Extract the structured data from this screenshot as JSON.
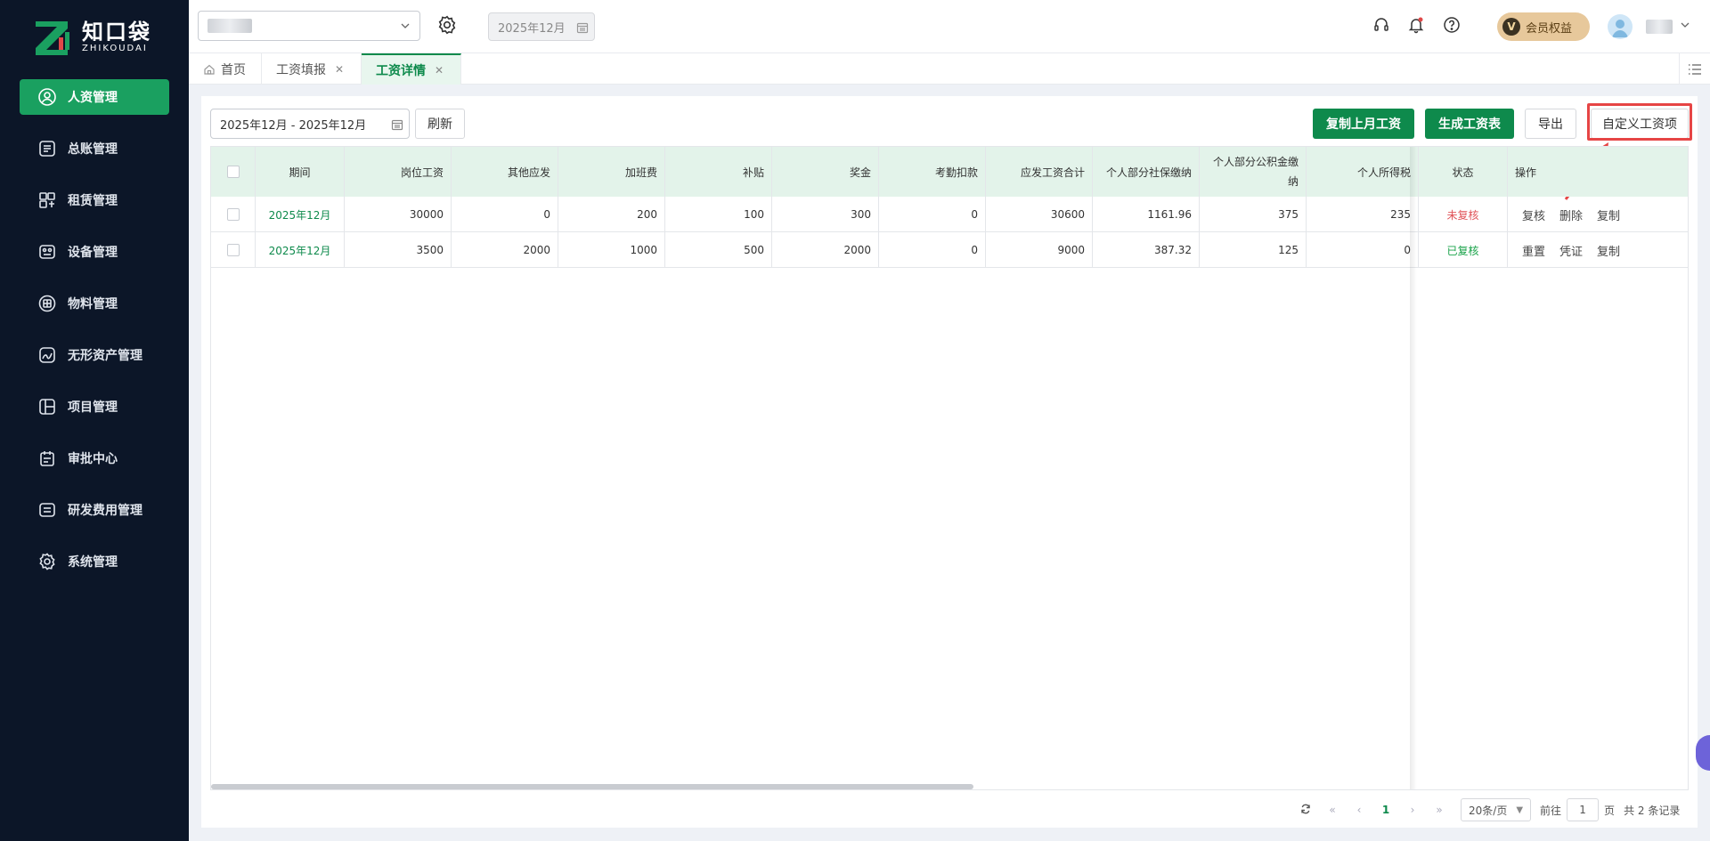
{
  "logo": {
    "cn": "知口袋",
    "en": "ZHIKOUDAI"
  },
  "sidebar": {
    "items": [
      {
        "label": "人资管理",
        "icon": "user-circle-icon",
        "active": true
      },
      {
        "label": "总账管理",
        "icon": "ledger-icon"
      },
      {
        "label": "租赁管理",
        "icon": "lease-icon"
      },
      {
        "label": "设备管理",
        "icon": "device-icon"
      },
      {
        "label": "物料管理",
        "icon": "material-icon"
      },
      {
        "label": "无形资产管理",
        "icon": "intangible-asset-icon"
      },
      {
        "label": "项目管理",
        "icon": "project-icon"
      },
      {
        "label": "审批中心",
        "icon": "approval-icon"
      },
      {
        "label": "研发费用管理",
        "icon": "rd-expense-icon"
      },
      {
        "label": "系统管理",
        "icon": "gear-icon"
      }
    ]
  },
  "header": {
    "period": "2025年12月",
    "vip_label": "会员权益",
    "vip_badge": "V"
  },
  "tabs": [
    {
      "label": "首页"
    },
    {
      "label": "工资填报"
    },
    {
      "label": "工资详情",
      "active": true
    }
  ],
  "toolbar": {
    "date_range": "2025年12月 - 2025年12月",
    "refresh": "刷新",
    "copy_last_month": "复制上月工资",
    "generate_sheet": "生成工资表",
    "export": "导出",
    "custom_items": "自定义工资项"
  },
  "table": {
    "headers": [
      "期间",
      "岗位工资",
      "其他应发",
      "加班费",
      "补贴",
      "奖金",
      "考勤扣款",
      "应发工资合计",
      "个人部分社保缴纳",
      "个人部分公积金缴纳",
      "个人所得税",
      "状态",
      "操作"
    ],
    "rows": [
      {
        "period": "2025年12月",
        "post_salary": "30000",
        "other": "0",
        "overtime": "200",
        "subsidy": "100",
        "bonus": "300",
        "attendance": "0",
        "total": "30600",
        "social": "1161.96",
        "fund": "375",
        "tax": "235",
        "status": "未复核",
        "ops": [
          "复核",
          "删除",
          "复制"
        ]
      },
      {
        "period": "2025年12月",
        "post_salary": "3500",
        "other": "2000",
        "overtime": "1000",
        "subsidy": "500",
        "bonus": "2000",
        "attendance": "0",
        "total": "9000",
        "social": "387.32",
        "fund": "125",
        "tax": "0",
        "status": "已复核",
        "ops": [
          "重置",
          "凭证",
          "复制"
        ]
      }
    ]
  },
  "pagination": {
    "current": "1",
    "page_size": "20条/页",
    "goto_label": "前往",
    "goto_value": "1",
    "page_unit": "页",
    "total": "共 2 条记录"
  },
  "colors": {
    "brand": "#0e8a4c",
    "sidebar": "#0c1628",
    "highlight": "#e64545"
  }
}
